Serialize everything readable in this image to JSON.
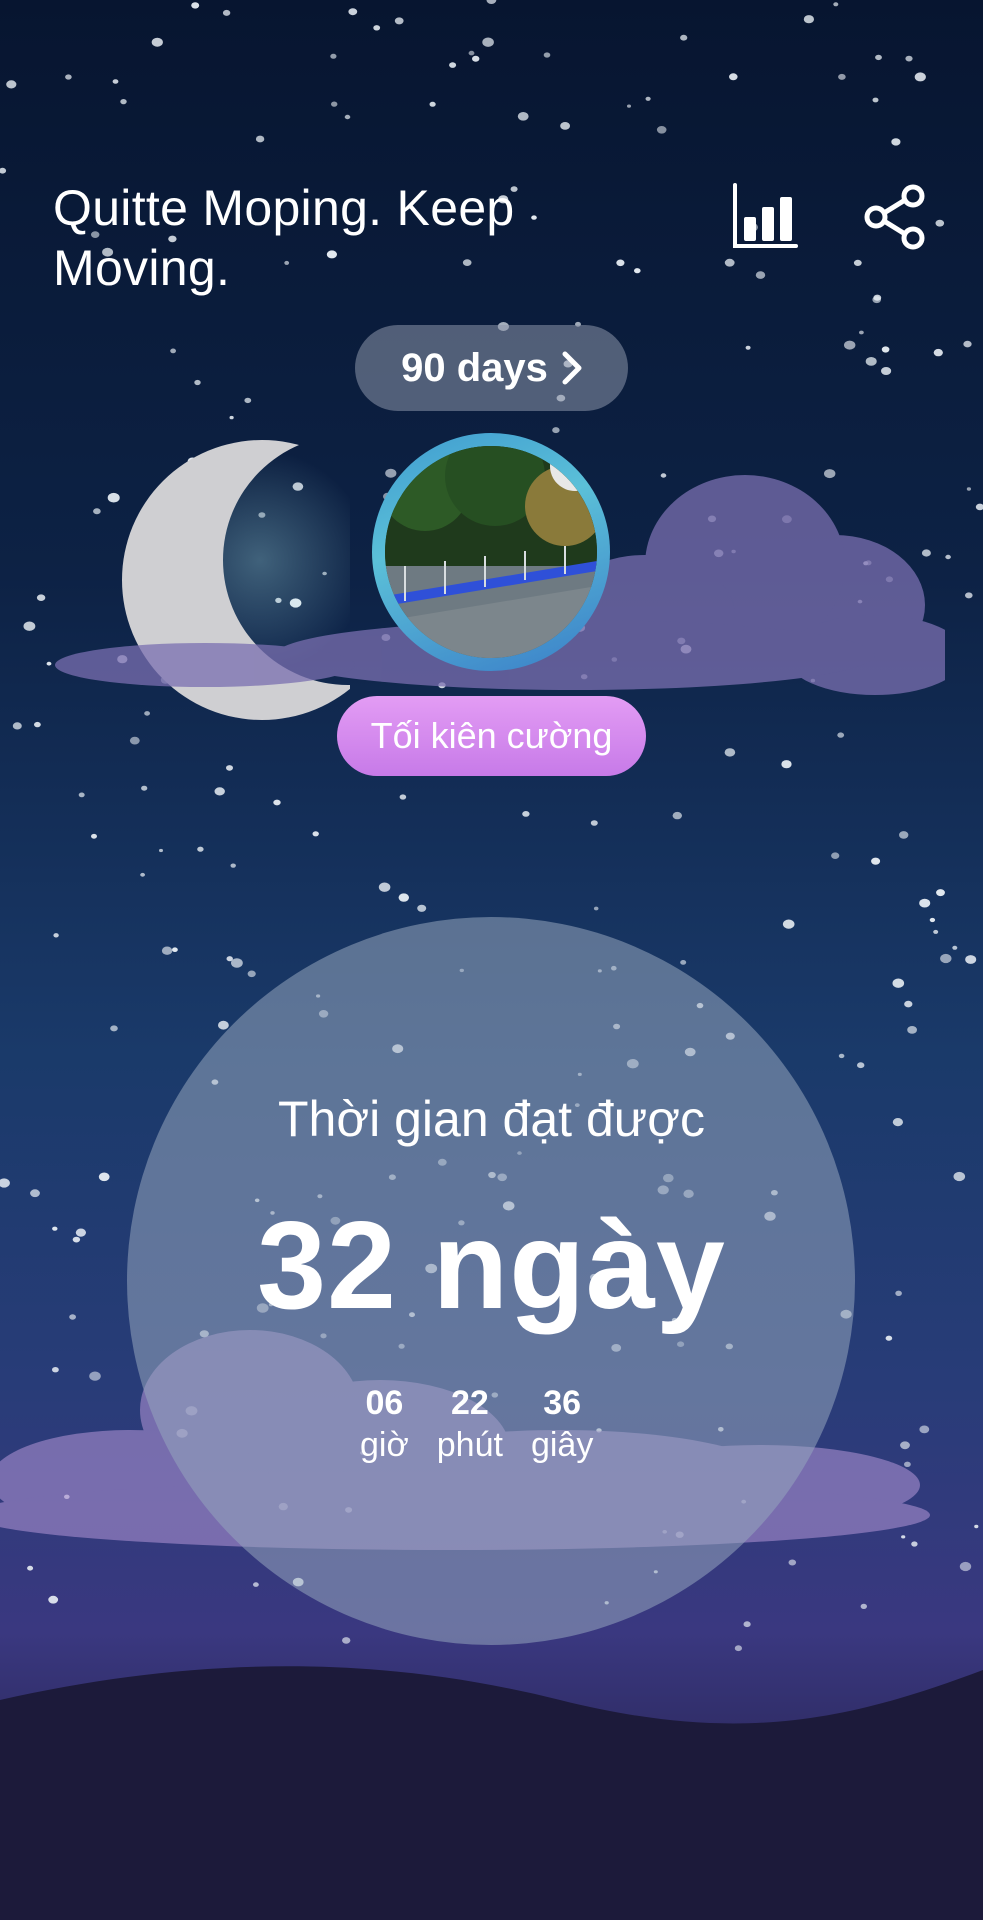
{
  "header": {
    "title": "Quitte Moping. Keep Moving.",
    "stats_icon": "bar-chart-icon",
    "share_icon": "share-icon"
  },
  "goal": {
    "label": "90 days",
    "chevron_icon": "chevron-right-icon"
  },
  "profile": {
    "rank_label": "Tối kiên cường"
  },
  "timer": {
    "label": "Thời gian đạt được",
    "days": "32 ngày",
    "parts": [
      {
        "value": "06",
        "unit": "giờ"
      },
      {
        "value": "22",
        "unit": "phút"
      },
      {
        "value": "36",
        "unit": "giây"
      }
    ]
  },
  "colors": {
    "sky_top": "#071530",
    "sky_bottom": "#3a3880",
    "rank_badge": "#d98ef0",
    "avatar_ring": "#4fb3d6"
  }
}
